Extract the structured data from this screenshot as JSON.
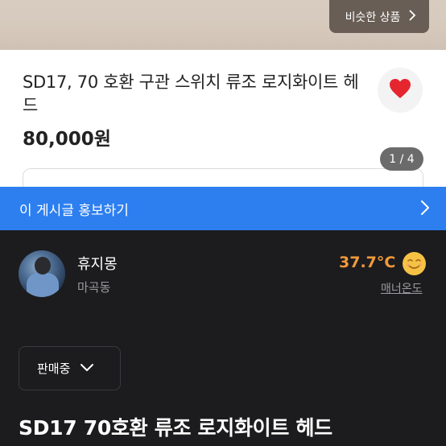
{
  "gallery": {
    "similar_button_label": "비슷한 상품",
    "page_indicator": "1 / 4"
  },
  "product": {
    "title": "SD17, 70 호환 구관 스위치 류조 로지화이트 헤드",
    "price": "80,000원"
  },
  "promo": {
    "label": "이 게시글 홍보하기"
  },
  "seller": {
    "name": "휴지몽",
    "location": "마곡동",
    "temperature": "37.7°C",
    "manner_label": "매너온도"
  },
  "listing": {
    "status_label": "판매중",
    "title": "SD17 70호환 류조 로지화이트 헤드"
  },
  "colors": {
    "promo_bar": "#2d7ff0",
    "heart": "#e5262f",
    "temperature": "#f29a3b",
    "dark_bg": "#1c1c1e"
  },
  "icons": {
    "heart": "heart-icon",
    "chevron_right": "chevron-right-icon",
    "chevron_down": "chevron-down-icon",
    "smile": "smile-icon"
  }
}
